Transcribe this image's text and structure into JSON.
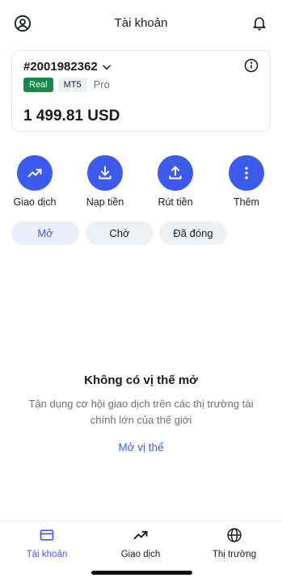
{
  "header": {
    "title": "Tài khoản",
    "profile_icon": "user-circle-icon",
    "notification_icon": "bell-icon"
  },
  "account": {
    "number": "#2001982362",
    "badges": {
      "type": "Real",
      "platform": "MT5",
      "tier": "Pro"
    },
    "balance": "1 499.81 USD",
    "colors": {
      "real_badge": "#138a4c",
      "accent": "#3c5bec"
    }
  },
  "actions": [
    {
      "label": "Giao dịch",
      "icon": "trending-up-icon"
    },
    {
      "label": "Nạp tiền",
      "icon": "download-icon"
    },
    {
      "label": "Rút tiền",
      "icon": "upload-icon"
    },
    {
      "label": "Thêm",
      "icon": "more-vertical-icon"
    }
  ],
  "tabs": [
    {
      "label": "Mở",
      "active": true
    },
    {
      "label": "Chờ",
      "active": false
    },
    {
      "label": "Đã đóng",
      "active": false
    }
  ],
  "empty_state": {
    "title": "Không có vị thế mở",
    "description": "Tận dụng cơ hội giao dịch trên các thị trường tài chính lớn của thế giới",
    "link": "Mở vị thế"
  },
  "bottom_nav": [
    {
      "label": "Tài khoản",
      "icon": "wallet-card-icon",
      "active": true
    },
    {
      "label": "Giao dịch",
      "icon": "trending-up-icon",
      "active": false
    },
    {
      "label": "Thị trường",
      "icon": "globe-icon",
      "active": false
    }
  ]
}
